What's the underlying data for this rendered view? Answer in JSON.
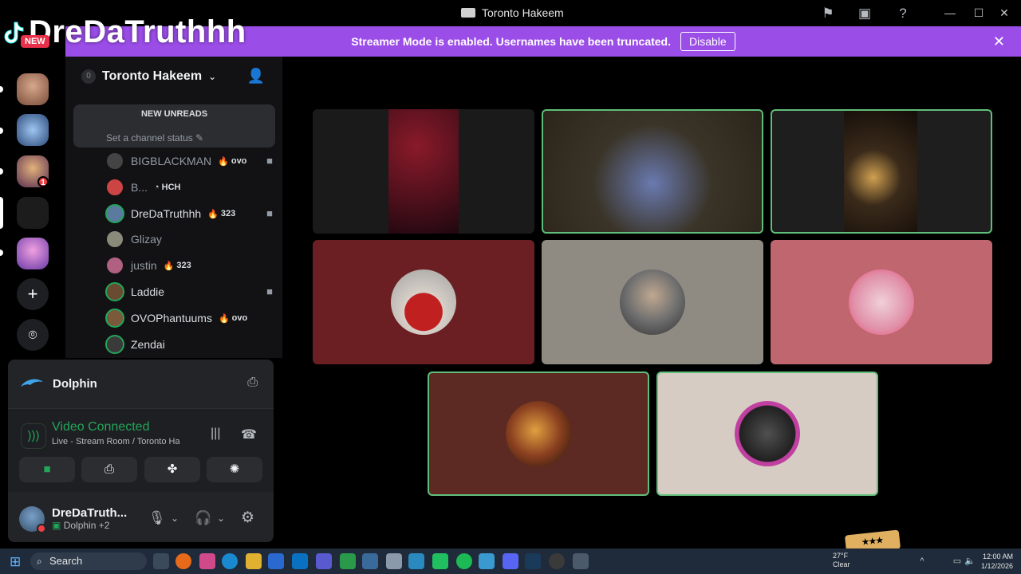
{
  "window": {
    "title": "Toronto Hakeem",
    "icons": {
      "inbox": "flag-icon",
      "screen": "screen-icon",
      "help": "help-icon"
    },
    "controls": {
      "minimize": "—",
      "maximize": "☐",
      "close": "✕"
    }
  },
  "overlay": {
    "watermark_name": "DreDaTruthhh",
    "new_badge": "NEW"
  },
  "banner": {
    "text": "Streamer Mode is enabled. Usernames have been truncated.",
    "button": "Disable",
    "close": "✕",
    "color": "#9b4de8"
  },
  "guilds": {
    "badge_count": "1",
    "add_label": "+",
    "discover_label": "⌾"
  },
  "server": {
    "name": "Toronto Hakeem",
    "icon_text": "0"
  },
  "channel_list": {
    "unreads_label": "NEW UNREADS",
    "channel_status": "Set a channel status",
    "members": [
      {
        "name": "BIGBLACKMAN",
        "tag": "ovo",
        "tag_icon": "🔥",
        "camera": true,
        "dim": true
      },
      {
        "name": "B...",
        "tag": "HCH",
        "tag_icon": "◔",
        "camera": false,
        "dim": true
      },
      {
        "name": "DreDaTruthhh",
        "tag": "323",
        "tag_icon": "🔥",
        "camera": true,
        "dim": false
      },
      {
        "name": "Glizay",
        "tag": "",
        "tag_icon": "",
        "camera": false,
        "dim": true
      },
      {
        "name": "justin",
        "tag": "323",
        "tag_icon": "🔥",
        "camera": false,
        "dim": true
      },
      {
        "name": "Laddie",
        "tag": "",
        "tag_icon": "",
        "camera": true,
        "dim": false
      },
      {
        "name": "OVOPhantuums",
        "tag": "ovo",
        "tag_icon": "🔥",
        "camera": false,
        "dim": false
      },
      {
        "name": "Zendai",
        "tag": "",
        "tag_icon": "",
        "camera": false,
        "dim": false
      }
    ]
  },
  "activity": {
    "name": "Dolphin"
  },
  "voice": {
    "status": "Video Connected",
    "location": "Live - Stream Room / Toronto Ha...",
    "status_color": "#23a55a",
    "buttons": [
      "camera-icon",
      "screenshare-icon",
      "activities-icon",
      "soundboard-icon"
    ]
  },
  "user": {
    "name": "DreDaTruth...",
    "activity": "Dolphin",
    "activity_extra": "+2"
  },
  "stage": {
    "tiles": [
      {
        "label": "participant-1",
        "kind": "video"
      },
      {
        "label": "participant-2",
        "kind": "video"
      },
      {
        "label": "participant-3",
        "kind": "video"
      },
      {
        "label": "participant-4",
        "kind": "avatar",
        "bg": "#6b1f22"
      },
      {
        "label": "participant-5",
        "kind": "avatar",
        "bg": "#8f8a82"
      },
      {
        "label": "participant-6",
        "kind": "avatar",
        "bg": "#c0666f"
      },
      {
        "label": "participant-7",
        "kind": "avatar",
        "bg": "#5c2a22"
      },
      {
        "label": "participant-8",
        "kind": "avatar",
        "bg": "#d6ccc4"
      }
    ]
  },
  "taskbar": {
    "search": "Search",
    "weather_temp": "27°F",
    "weather_desc": "Clear",
    "time": "12:00 AM",
    "date": "1/12/2026"
  }
}
